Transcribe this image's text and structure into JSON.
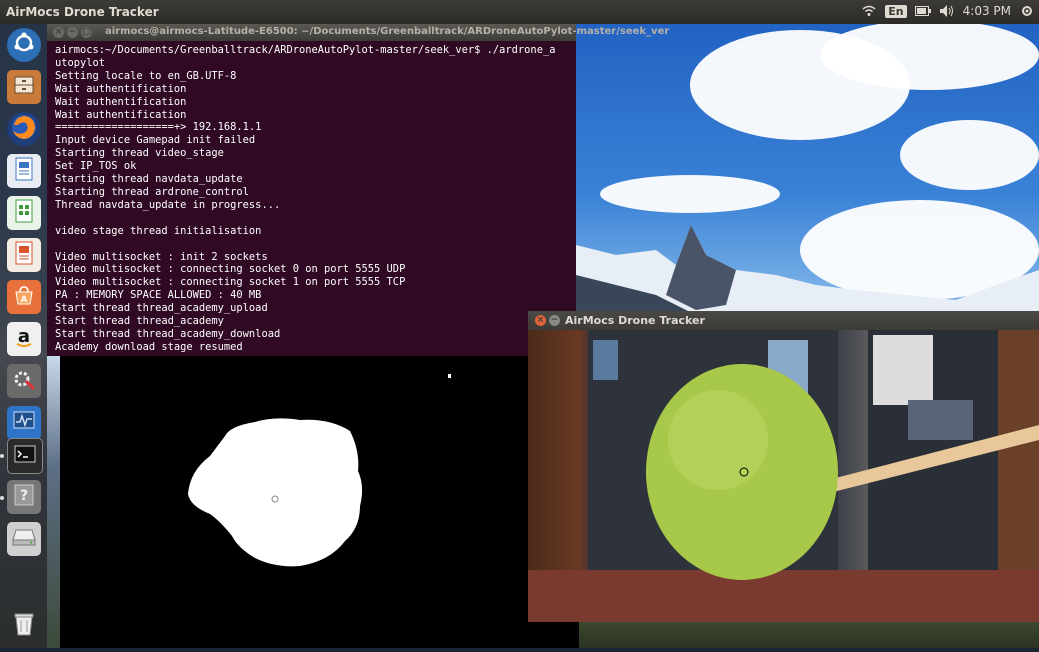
{
  "top_panel": {
    "app_title": "AirMocs Drone Tracker",
    "keyboard_layout": "En",
    "clock": "4:03 PM"
  },
  "launcher": {
    "items": [
      {
        "name": "dash-home",
        "icon": "ubuntu-logo-icon",
        "color": "#2c6fb4"
      },
      {
        "name": "files",
        "icon": "file-cabinet-icon",
        "color": "#e3763b"
      },
      {
        "name": "firefox",
        "icon": "firefox-icon",
        "color": "#e66000"
      },
      {
        "name": "writer",
        "icon": "writer-document-icon",
        "color": "#3a76c2"
      },
      {
        "name": "calc",
        "icon": "spreadsheet-icon",
        "color": "#3d9b3d"
      },
      {
        "name": "impress",
        "icon": "presentation-icon",
        "color": "#d9542b"
      },
      {
        "name": "software-center",
        "icon": "software-center-icon",
        "color": "#e8703a"
      },
      {
        "name": "amazon",
        "icon": "amazon-icon",
        "color": "#f0f0f0"
      },
      {
        "name": "system-settings",
        "icon": "settings-icon",
        "color": "#777"
      },
      {
        "name": "system-monitor",
        "icon": "system-monitor-icon",
        "color": "#2e74c8"
      },
      {
        "name": "terminal",
        "icon": "terminal-icon",
        "color": "#3a3a3a"
      },
      {
        "name": "unknown-app",
        "icon": "question-icon",
        "color": "#666"
      },
      {
        "name": "disk",
        "icon": "disk-drive-icon",
        "color": "#bbb"
      },
      {
        "name": "trash",
        "icon": "trash-icon",
        "color": "#cfcfcf"
      }
    ]
  },
  "terminal": {
    "title": "airmocs@airmocs-Latitude-E6500: ~/Documents/Greenballtrack/ARDroneAutoPylot-master/seek_ver",
    "lines": [
      "airmocs:~/Documents/Greenballtrack/ARDroneAutoPylot-master/seek_ver$ ./ardrone_a",
      "utopylot",
      "Setting locale to en_GB.UTF-8",
      "Wait authentification",
      "Wait authentification",
      "Wait authentification",
      "===================+> 192.168.1.1",
      "Input device Gamepad init failed",
      "Starting thread video_stage",
      "Set IP_TOS ok",
      "Starting thread navdata_update",
      "Starting thread ardrone_control",
      "Thread navdata_update in progress...",
      "",
      "video stage thread initialisation",
      "",
      "Video multisocket : init 2 sockets",
      "Video multisocket : connecting socket 0 on port 5555 UDP",
      "Video multisocket : connecting socket 1 on port 5555 TCP",
      "PA : MEMORY SPACE ALLOWED : 40 MB",
      "Start thread thread_academy_upload",
      "Start thread thread_academy",
      "Start thread thread_academy_download",
      "Academy download stage resumed"
    ]
  },
  "tracker_window": {
    "title": "AirMocs Drone Tracker",
    "subject": "green-ball"
  }
}
